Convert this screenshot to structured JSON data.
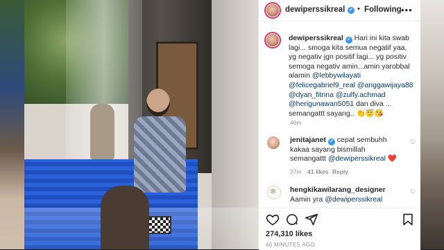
{
  "post": {
    "username": "dewiperssikreal",
    "follow_separator": "•",
    "follow_label": "Following",
    "more_label": "•••"
  },
  "caption": {
    "username": "dewiperssikreal",
    "line1": "Hari ini kita swab",
    "line2": "lagi... smoga kita semua negatif yaa,",
    "line3": "yg negativ jgn positif lagi... yg positiv",
    "line4": "semoga negativ amin...amin yarobbal",
    "line5a": "alamin",
    "m1": "@lebbywilayati",
    "m2": "@felicegabriel9_real",
    "m3": "@anggawijaya88",
    "m4": "@dyan_fitrina",
    "m5": "@zulfy.achmad",
    "m6": "@herigunawan5051",
    "line8b": "dan diva ...",
    "line9": "semangattt sayang..",
    "emoji": "👏😇😘",
    "time": "46m"
  },
  "comments": [
    {
      "username": "jenitajanet",
      "text1": "cepat sembuhh",
      "text2": "kakaa sayang bismillah",
      "text3": "semangattt",
      "mention": "@dewiperssikreal",
      "emoji": "❤️",
      "time": "27m",
      "likes": "41 likes",
      "reply": "Reply"
    },
    {
      "username": "hengkikawilarang_designer",
      "text": "Aamin yra",
      "mention": "@dewiperssikreal"
    }
  ],
  "stats": {
    "likes": "274,310 likes",
    "time": "46 MINUTES AGO"
  },
  "colors": {
    "verified": "#3897f0",
    "mention": "#00376b",
    "heart": "#ed4956"
  },
  "icons": [
    "heart-icon",
    "comment-icon",
    "share-icon",
    "save-icon",
    "verified-icon",
    "more-icon"
  ]
}
